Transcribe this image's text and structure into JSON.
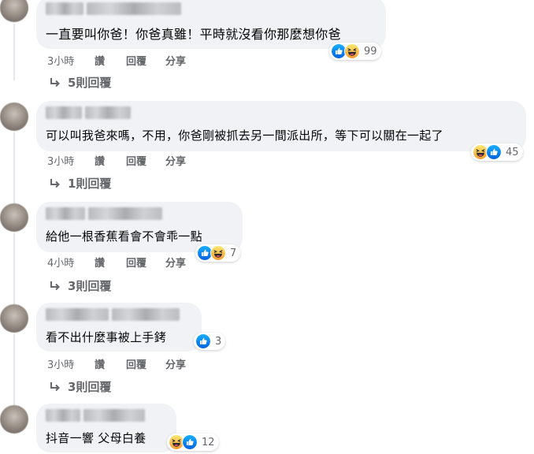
{
  "comments": [
    {
      "text": "一直要叫你爸！你爸真雖！平時就沒看你那麼想你爸",
      "reaction_count": "99",
      "reactions": [
        "like-icon",
        "haha-icon"
      ],
      "time": "3小時",
      "like_label": "讚",
      "reply_label": "回覆",
      "share_label": "分享",
      "replies_label": "5則回覆"
    },
    {
      "text": "可以叫我爸來嗎，不用，你爸剛被抓去另一間派出所，等下可以關在一起了",
      "reaction_count": "45",
      "reactions": [
        "haha-icon",
        "like-icon"
      ],
      "time": "3小時",
      "like_label": "讚",
      "reply_label": "回覆",
      "share_label": "分享",
      "replies_label": "1則回覆"
    },
    {
      "text": "給他一根香蕉看會不會乖一點",
      "reaction_count": "7",
      "reactions": [
        "like-icon",
        "haha-icon"
      ],
      "time": "4小時",
      "like_label": "讚",
      "reply_label": "回覆",
      "share_label": "分享",
      "replies_label": "3則回覆"
    },
    {
      "text": "看不出什麼事被上手銬",
      "reaction_count": "3",
      "reactions": [
        "like-icon"
      ],
      "time": "3小時",
      "like_label": "讚",
      "reply_label": "回覆",
      "share_label": "分享",
      "replies_label": "3則回覆"
    },
    {
      "text": "抖音一響 父母白養",
      "reaction_count": "12",
      "reactions": [
        "haha-icon",
        "like-icon"
      ]
    }
  ],
  "colors": {
    "bubble": "#f0f2f5",
    "meta_text": "#65676b",
    "like_blue": "#1877f2",
    "haha_yellow": "#f7b125"
  }
}
